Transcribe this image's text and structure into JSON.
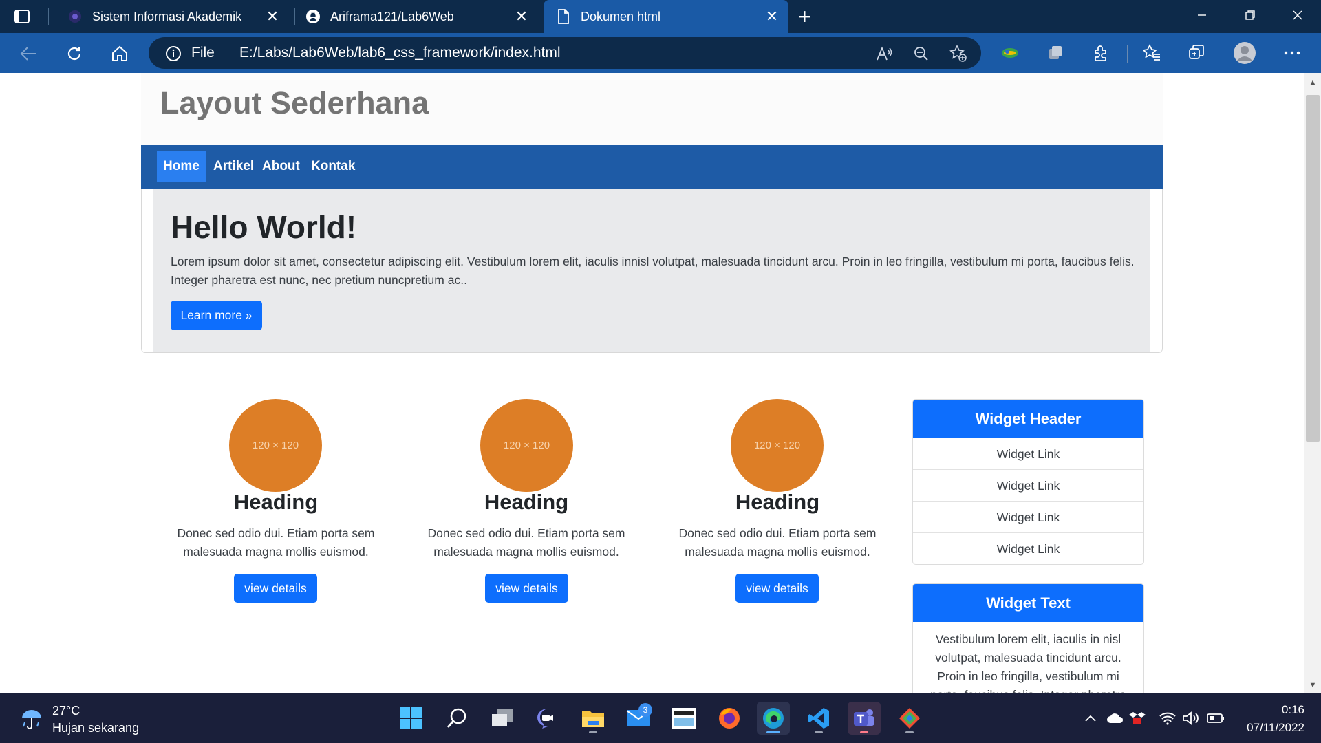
{
  "browser": {
    "tabs": [
      {
        "title": "Sistem Informasi Akademik",
        "icon": "academic-logo-icon",
        "active": false
      },
      {
        "title": "Ariframa121/Lab6Web",
        "icon": "github-icon",
        "active": false
      },
      {
        "title": "Dokumen html",
        "icon": "document-icon",
        "active": true
      }
    ],
    "tab_close_glyph": "✕",
    "new_tab_glyph": "+",
    "address": {
      "scheme_label": "File",
      "url": "E:/Labs/Lab6Web/lab6_css_framework/index.html"
    },
    "colors": {
      "tabbar": "#0d2a4a",
      "active_tab": "#1a5aa6",
      "toolbar": "#1a5aa6"
    }
  },
  "page": {
    "site_title": "Layout Sederhana",
    "nav": [
      "Home",
      "Artikel",
      "About",
      "Kontak"
    ],
    "nav_active": "Home",
    "jumbotron": {
      "title": "Hello World!",
      "text": "Lorem ipsum dolor sit amet, consectetur adipiscing elit. Vestibulum lorem elit, iaculis innisl volutpat, malesuada tincidunt arcu. Proin in leo fringilla, vestibulum mi porta, faucibus felis. Integer pharetra est nunc, nec pretium nuncpretium ac..",
      "button": "Learn more »"
    },
    "features": [
      {
        "image_label": "120 × 120",
        "heading": "Heading",
        "text": "Donec sed odio dui. Etiam porta sem malesuada magna mollis euismod.",
        "button": "view details"
      },
      {
        "image_label": "120 × 120",
        "heading": "Heading",
        "text": "Donec sed odio dui. Etiam porta sem malesuada magna mollis euismod.",
        "button": "view details"
      },
      {
        "image_label": "120 × 120",
        "heading": "Heading",
        "text": "Donec sed odio dui. Etiam porta sem malesuada magna mollis euismod.",
        "button": "view details"
      }
    ],
    "widget_links": {
      "header": "Widget Header",
      "links": [
        "Widget Link",
        "Widget Link",
        "Widget Link",
        "Widget Link"
      ]
    },
    "widget_text": {
      "header": "Widget Text",
      "text": "Vestibulum lorem elit, iaculis in nisl volutpat, malesuada tincidunt arcu. Proin in leo fringilla, vestibulum mi porta, faucibus felis. Integer pharetra"
    },
    "colors": {
      "nav": "#1e5ba6",
      "primary": "#0d6efd",
      "feature_image": "#dd7e26",
      "jumbotron_bg": "#e9eaec"
    }
  },
  "taskbar": {
    "weather_temp": "27°C",
    "weather_desc": "Hujan sekarang",
    "mail_badge": "3",
    "apps": [
      "windows-start-icon",
      "search-icon",
      "task-view-icon",
      "chat-icon",
      "file-explorer-icon",
      "mail-icon",
      "amazon-icon",
      "firefox-icon",
      "edge-icon",
      "vscode-icon",
      "teams-icon",
      "git-icon"
    ],
    "time": "0:16",
    "date": "07/11/2022"
  }
}
